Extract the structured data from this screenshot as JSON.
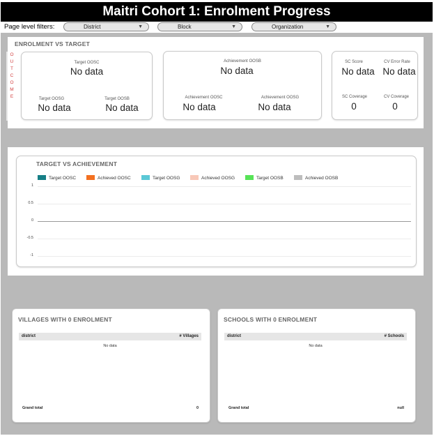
{
  "header": {
    "title": "Maitri Cohort 1: Enrolment Progress"
  },
  "filters": {
    "label": "Page level filters:",
    "district": "District",
    "block": "Block",
    "organization": "Organization"
  },
  "enrolment": {
    "title": "ENROLMENT VS TARGET",
    "outcome_letters": [
      "O",
      "U",
      "T",
      "C",
      "O",
      "M",
      "E"
    ],
    "target_oosc": {
      "label": "Target OOSC",
      "value": "No data"
    },
    "target_oosg": {
      "label": "Target OOSG",
      "value": "No data"
    },
    "target_oosb": {
      "label": "Target OOSB",
      "value": "No data"
    },
    "achievement_oosb": {
      "label": "Achievement OOSB",
      "value": "No data"
    },
    "achievement_oosc": {
      "label": "Achievement OOSC",
      "value": "No data"
    },
    "achievement_oosg": {
      "label": "Achievement OOSG",
      "value": "No data"
    },
    "sc_score": {
      "label": "SC Score",
      "value": "No data"
    },
    "cv_error_rate": {
      "label": "CV Error Rate",
      "value": "No data"
    },
    "sc_coverage": {
      "label": "SC Coverage",
      "value": "0"
    },
    "cv_coverage": {
      "label": "CV Coverage",
      "value": "0"
    }
  },
  "chart_data": {
    "type": "line",
    "title": "TARGET VS ACHIEVEMENT",
    "series": [
      {
        "name": "Target OOSC",
        "color": "#167f86",
        "values": []
      },
      {
        "name": "Achieved OOSC",
        "color": "#f37021",
        "values": []
      },
      {
        "name": "Target OOSG",
        "color": "#5bc8d6",
        "values": []
      },
      {
        "name": "Achieved OOSG",
        "color": "#f8c8b8",
        "values": []
      },
      {
        "name": "Target OOSB",
        "color": "#57e357",
        "values": []
      },
      {
        "name": "Achieved OOSB",
        "color": "#bdbdbd",
        "values": []
      }
    ],
    "yticks": [
      "1",
      "0.5",
      "0",
      "-0.5",
      "-1"
    ],
    "ylim": [
      -1,
      1
    ],
    "legend": "top-left",
    "grid": true
  },
  "villages": {
    "title": "VILLAGES WITH 0 ENROLMENT",
    "col1": "district",
    "col2": "# Villages",
    "nodata": "No data",
    "grand_total_label": "Grand total",
    "grand_total_value": "0"
  },
  "schools": {
    "title": "SCHOOLS WITH 0 ENROLMENT",
    "col1": "district",
    "col2": "# Schools",
    "nodata": "No data",
    "grand_total_label": "Grand total",
    "grand_total_value": "null"
  }
}
